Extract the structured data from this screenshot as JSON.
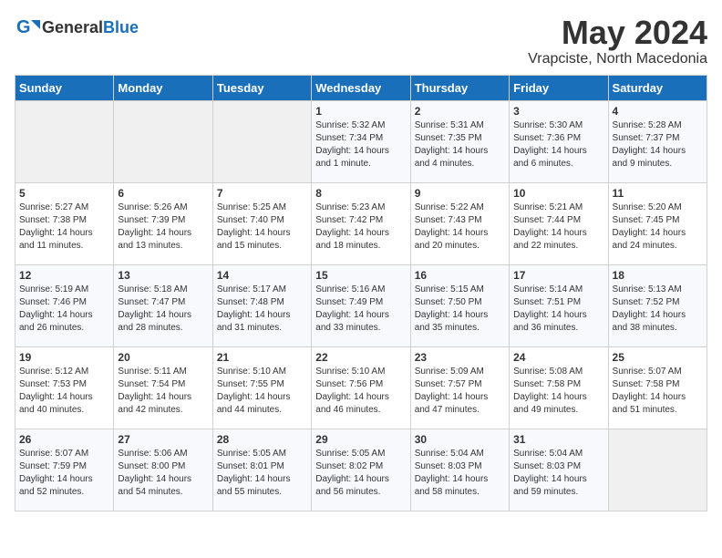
{
  "header": {
    "logo_general": "General",
    "logo_blue": "Blue",
    "month_title": "May 2024",
    "subtitle": "Vrapciste, North Macedonia"
  },
  "days_of_week": [
    "Sunday",
    "Monday",
    "Tuesday",
    "Wednesday",
    "Thursday",
    "Friday",
    "Saturday"
  ],
  "weeks": [
    [
      {
        "day": "",
        "content": ""
      },
      {
        "day": "",
        "content": ""
      },
      {
        "day": "",
        "content": ""
      },
      {
        "day": "1",
        "content": "Sunrise: 5:32 AM\nSunset: 7:34 PM\nDaylight: 14 hours\nand 1 minute."
      },
      {
        "day": "2",
        "content": "Sunrise: 5:31 AM\nSunset: 7:35 PM\nDaylight: 14 hours\nand 4 minutes."
      },
      {
        "day": "3",
        "content": "Sunrise: 5:30 AM\nSunset: 7:36 PM\nDaylight: 14 hours\nand 6 minutes."
      },
      {
        "day": "4",
        "content": "Sunrise: 5:28 AM\nSunset: 7:37 PM\nDaylight: 14 hours\nand 9 minutes."
      }
    ],
    [
      {
        "day": "5",
        "content": "Sunrise: 5:27 AM\nSunset: 7:38 PM\nDaylight: 14 hours\nand 11 minutes."
      },
      {
        "day": "6",
        "content": "Sunrise: 5:26 AM\nSunset: 7:39 PM\nDaylight: 14 hours\nand 13 minutes."
      },
      {
        "day": "7",
        "content": "Sunrise: 5:25 AM\nSunset: 7:40 PM\nDaylight: 14 hours\nand 15 minutes."
      },
      {
        "day": "8",
        "content": "Sunrise: 5:23 AM\nSunset: 7:42 PM\nDaylight: 14 hours\nand 18 minutes."
      },
      {
        "day": "9",
        "content": "Sunrise: 5:22 AM\nSunset: 7:43 PM\nDaylight: 14 hours\nand 20 minutes."
      },
      {
        "day": "10",
        "content": "Sunrise: 5:21 AM\nSunset: 7:44 PM\nDaylight: 14 hours\nand 22 minutes."
      },
      {
        "day": "11",
        "content": "Sunrise: 5:20 AM\nSunset: 7:45 PM\nDaylight: 14 hours\nand 24 minutes."
      }
    ],
    [
      {
        "day": "12",
        "content": "Sunrise: 5:19 AM\nSunset: 7:46 PM\nDaylight: 14 hours\nand 26 minutes."
      },
      {
        "day": "13",
        "content": "Sunrise: 5:18 AM\nSunset: 7:47 PM\nDaylight: 14 hours\nand 28 minutes."
      },
      {
        "day": "14",
        "content": "Sunrise: 5:17 AM\nSunset: 7:48 PM\nDaylight: 14 hours\nand 31 minutes."
      },
      {
        "day": "15",
        "content": "Sunrise: 5:16 AM\nSunset: 7:49 PM\nDaylight: 14 hours\nand 33 minutes."
      },
      {
        "day": "16",
        "content": "Sunrise: 5:15 AM\nSunset: 7:50 PM\nDaylight: 14 hours\nand 35 minutes."
      },
      {
        "day": "17",
        "content": "Sunrise: 5:14 AM\nSunset: 7:51 PM\nDaylight: 14 hours\nand 36 minutes."
      },
      {
        "day": "18",
        "content": "Sunrise: 5:13 AM\nSunset: 7:52 PM\nDaylight: 14 hours\nand 38 minutes."
      }
    ],
    [
      {
        "day": "19",
        "content": "Sunrise: 5:12 AM\nSunset: 7:53 PM\nDaylight: 14 hours\nand 40 minutes."
      },
      {
        "day": "20",
        "content": "Sunrise: 5:11 AM\nSunset: 7:54 PM\nDaylight: 14 hours\nand 42 minutes."
      },
      {
        "day": "21",
        "content": "Sunrise: 5:10 AM\nSunset: 7:55 PM\nDaylight: 14 hours\nand 44 minutes."
      },
      {
        "day": "22",
        "content": "Sunrise: 5:10 AM\nSunset: 7:56 PM\nDaylight: 14 hours\nand 46 minutes."
      },
      {
        "day": "23",
        "content": "Sunrise: 5:09 AM\nSunset: 7:57 PM\nDaylight: 14 hours\nand 47 minutes."
      },
      {
        "day": "24",
        "content": "Sunrise: 5:08 AM\nSunset: 7:58 PM\nDaylight: 14 hours\nand 49 minutes."
      },
      {
        "day": "25",
        "content": "Sunrise: 5:07 AM\nSunset: 7:58 PM\nDaylight: 14 hours\nand 51 minutes."
      }
    ],
    [
      {
        "day": "26",
        "content": "Sunrise: 5:07 AM\nSunset: 7:59 PM\nDaylight: 14 hours\nand 52 minutes."
      },
      {
        "day": "27",
        "content": "Sunrise: 5:06 AM\nSunset: 8:00 PM\nDaylight: 14 hours\nand 54 minutes."
      },
      {
        "day": "28",
        "content": "Sunrise: 5:05 AM\nSunset: 8:01 PM\nDaylight: 14 hours\nand 55 minutes."
      },
      {
        "day": "29",
        "content": "Sunrise: 5:05 AM\nSunset: 8:02 PM\nDaylight: 14 hours\nand 56 minutes."
      },
      {
        "day": "30",
        "content": "Sunrise: 5:04 AM\nSunset: 8:03 PM\nDaylight: 14 hours\nand 58 minutes."
      },
      {
        "day": "31",
        "content": "Sunrise: 5:04 AM\nSunset: 8:03 PM\nDaylight: 14 hours\nand 59 minutes."
      },
      {
        "day": "",
        "content": ""
      }
    ]
  ]
}
